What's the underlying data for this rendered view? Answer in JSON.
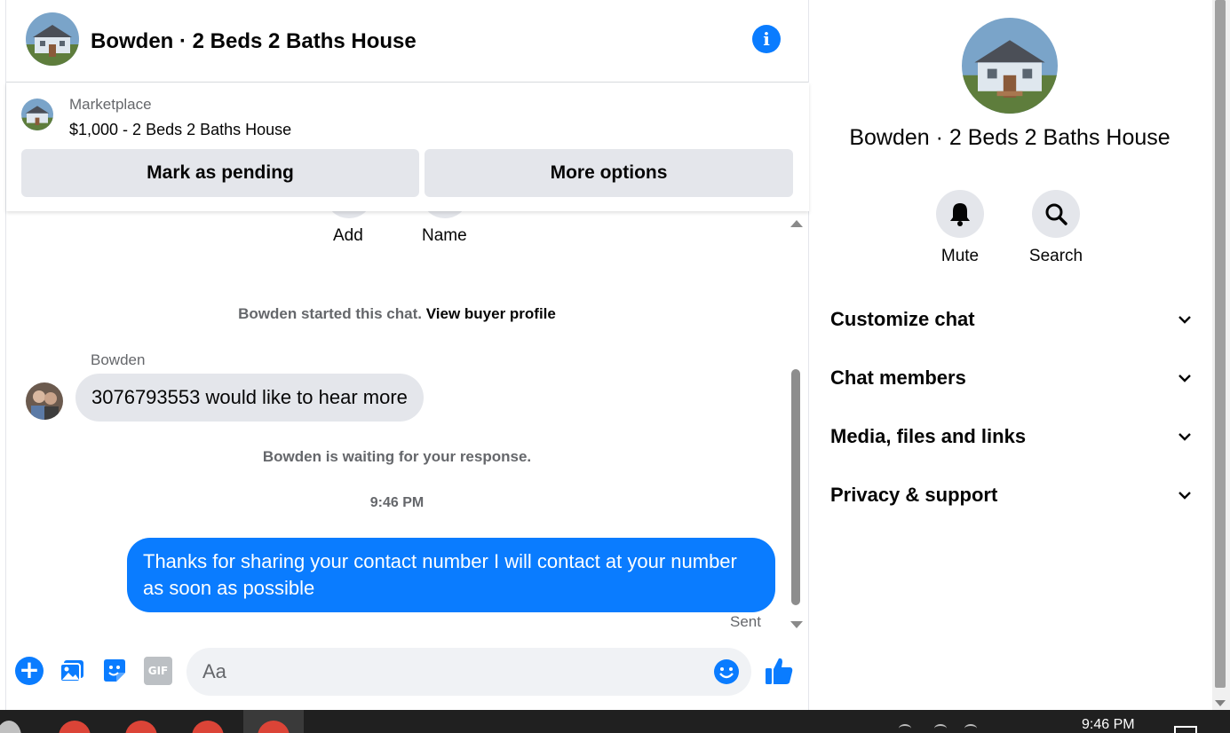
{
  "chat": {
    "header_title": "Bowden · 2 Beds 2 Baths House",
    "marketplace": {
      "label": "Marketplace",
      "listing": "$1,000 - 2 Beds 2 Baths House",
      "mark_pending": "Mark as pending",
      "more_options": "More options"
    },
    "actions": {
      "add": "Add",
      "name": "Name"
    },
    "started_text": "Bowden started this chat.",
    "view_profile": "View buyer profile",
    "sender_name": "Bowden",
    "incoming_message": "3076793553 would like to hear more",
    "waiting_text": "Bowden is waiting for your response.",
    "timestamp": "9:46 PM",
    "outgoing_message": "Thanks for sharing your contact number I will contact at your number as soon as possible",
    "sent_status": "Sent",
    "composer": {
      "placeholder": "Aa",
      "gif_label": "GIF"
    }
  },
  "info_panel": {
    "title": "Bowden · 2 Beds 2 Baths House",
    "mute_label": "Mute",
    "search_label": "Search",
    "sections": [
      "Customize chat",
      "Chat members",
      "Media, files and links",
      "Privacy & support"
    ]
  },
  "taskbar": {
    "clock": "9:46 PM"
  },
  "colors": {
    "accent": "#0a7cff",
    "bubble_in": "#e4e6eb",
    "button_bg": "#e4e6eb",
    "muted_text": "#65676b"
  }
}
